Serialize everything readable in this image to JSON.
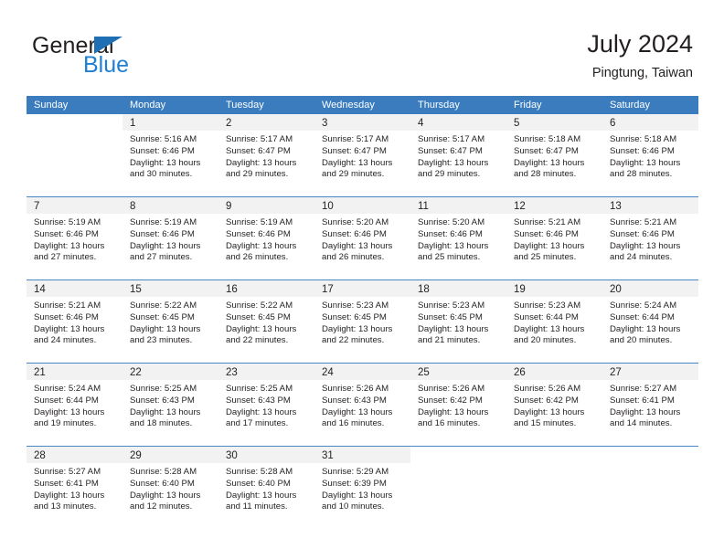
{
  "brand": {
    "name_part1": "General",
    "name_part2": "Blue",
    "triangle_color": "#1f6fb5",
    "blue_text_color": "#1f7fd0"
  },
  "header": {
    "title": "July 2024",
    "subtitle": "Pingtung, Taiwan"
  },
  "theme": {
    "header_row_bg": "#3a7cbe",
    "header_row_text": "#ffffff",
    "day_number_strip_bg": "#f2f2f2",
    "row_separator": "#4a86c5",
    "body_text": "#231f20"
  },
  "weekdays": [
    "Sunday",
    "Monday",
    "Tuesday",
    "Wednesday",
    "Thursday",
    "Friday",
    "Saturday"
  ],
  "weeks": [
    [
      {
        "day": "",
        "sunrise": "",
        "sunset": "",
        "daylight_line1": "",
        "daylight_line2": ""
      },
      {
        "day": "1",
        "sunrise": "Sunrise: 5:16 AM",
        "sunset": "Sunset: 6:46 PM",
        "daylight_line1": "Daylight: 13 hours",
        "daylight_line2": "and 30 minutes."
      },
      {
        "day": "2",
        "sunrise": "Sunrise: 5:17 AM",
        "sunset": "Sunset: 6:47 PM",
        "daylight_line1": "Daylight: 13 hours",
        "daylight_line2": "and 29 minutes."
      },
      {
        "day": "3",
        "sunrise": "Sunrise: 5:17 AM",
        "sunset": "Sunset: 6:47 PM",
        "daylight_line1": "Daylight: 13 hours",
        "daylight_line2": "and 29 minutes."
      },
      {
        "day": "4",
        "sunrise": "Sunrise: 5:17 AM",
        "sunset": "Sunset: 6:47 PM",
        "daylight_line1": "Daylight: 13 hours",
        "daylight_line2": "and 29 minutes."
      },
      {
        "day": "5",
        "sunrise": "Sunrise: 5:18 AM",
        "sunset": "Sunset: 6:47 PM",
        "daylight_line1": "Daylight: 13 hours",
        "daylight_line2": "and 28 minutes."
      },
      {
        "day": "6",
        "sunrise": "Sunrise: 5:18 AM",
        "sunset": "Sunset: 6:46 PM",
        "daylight_line1": "Daylight: 13 hours",
        "daylight_line2": "and 28 minutes."
      }
    ],
    [
      {
        "day": "7",
        "sunrise": "Sunrise: 5:19 AM",
        "sunset": "Sunset: 6:46 PM",
        "daylight_line1": "Daylight: 13 hours",
        "daylight_line2": "and 27 minutes."
      },
      {
        "day": "8",
        "sunrise": "Sunrise: 5:19 AM",
        "sunset": "Sunset: 6:46 PM",
        "daylight_line1": "Daylight: 13 hours",
        "daylight_line2": "and 27 minutes."
      },
      {
        "day": "9",
        "sunrise": "Sunrise: 5:19 AM",
        "sunset": "Sunset: 6:46 PM",
        "daylight_line1": "Daylight: 13 hours",
        "daylight_line2": "and 26 minutes."
      },
      {
        "day": "10",
        "sunrise": "Sunrise: 5:20 AM",
        "sunset": "Sunset: 6:46 PM",
        "daylight_line1": "Daylight: 13 hours",
        "daylight_line2": "and 26 minutes."
      },
      {
        "day": "11",
        "sunrise": "Sunrise: 5:20 AM",
        "sunset": "Sunset: 6:46 PM",
        "daylight_line1": "Daylight: 13 hours",
        "daylight_line2": "and 25 minutes."
      },
      {
        "day": "12",
        "sunrise": "Sunrise: 5:21 AM",
        "sunset": "Sunset: 6:46 PM",
        "daylight_line1": "Daylight: 13 hours",
        "daylight_line2": "and 25 minutes."
      },
      {
        "day": "13",
        "sunrise": "Sunrise: 5:21 AM",
        "sunset": "Sunset: 6:46 PM",
        "daylight_line1": "Daylight: 13 hours",
        "daylight_line2": "and 24 minutes."
      }
    ],
    [
      {
        "day": "14",
        "sunrise": "Sunrise: 5:21 AM",
        "sunset": "Sunset: 6:46 PM",
        "daylight_line1": "Daylight: 13 hours",
        "daylight_line2": "and 24 minutes."
      },
      {
        "day": "15",
        "sunrise": "Sunrise: 5:22 AM",
        "sunset": "Sunset: 6:45 PM",
        "daylight_line1": "Daylight: 13 hours",
        "daylight_line2": "and 23 minutes."
      },
      {
        "day": "16",
        "sunrise": "Sunrise: 5:22 AM",
        "sunset": "Sunset: 6:45 PM",
        "daylight_line1": "Daylight: 13 hours",
        "daylight_line2": "and 22 minutes."
      },
      {
        "day": "17",
        "sunrise": "Sunrise: 5:23 AM",
        "sunset": "Sunset: 6:45 PM",
        "daylight_line1": "Daylight: 13 hours",
        "daylight_line2": "and 22 minutes."
      },
      {
        "day": "18",
        "sunrise": "Sunrise: 5:23 AM",
        "sunset": "Sunset: 6:45 PM",
        "daylight_line1": "Daylight: 13 hours",
        "daylight_line2": "and 21 minutes."
      },
      {
        "day": "19",
        "sunrise": "Sunrise: 5:23 AM",
        "sunset": "Sunset: 6:44 PM",
        "daylight_line1": "Daylight: 13 hours",
        "daylight_line2": "and 20 minutes."
      },
      {
        "day": "20",
        "sunrise": "Sunrise: 5:24 AM",
        "sunset": "Sunset: 6:44 PM",
        "daylight_line1": "Daylight: 13 hours",
        "daylight_line2": "and 20 minutes."
      }
    ],
    [
      {
        "day": "21",
        "sunrise": "Sunrise: 5:24 AM",
        "sunset": "Sunset: 6:44 PM",
        "daylight_line1": "Daylight: 13 hours",
        "daylight_line2": "and 19 minutes."
      },
      {
        "day": "22",
        "sunrise": "Sunrise: 5:25 AM",
        "sunset": "Sunset: 6:43 PM",
        "daylight_line1": "Daylight: 13 hours",
        "daylight_line2": "and 18 minutes."
      },
      {
        "day": "23",
        "sunrise": "Sunrise: 5:25 AM",
        "sunset": "Sunset: 6:43 PM",
        "daylight_line1": "Daylight: 13 hours",
        "daylight_line2": "and 17 minutes."
      },
      {
        "day": "24",
        "sunrise": "Sunrise: 5:26 AM",
        "sunset": "Sunset: 6:43 PM",
        "daylight_line1": "Daylight: 13 hours",
        "daylight_line2": "and 16 minutes."
      },
      {
        "day": "25",
        "sunrise": "Sunrise: 5:26 AM",
        "sunset": "Sunset: 6:42 PM",
        "daylight_line1": "Daylight: 13 hours",
        "daylight_line2": "and 16 minutes."
      },
      {
        "day": "26",
        "sunrise": "Sunrise: 5:26 AM",
        "sunset": "Sunset: 6:42 PM",
        "daylight_line1": "Daylight: 13 hours",
        "daylight_line2": "and 15 minutes."
      },
      {
        "day": "27",
        "sunrise": "Sunrise: 5:27 AM",
        "sunset": "Sunset: 6:41 PM",
        "daylight_line1": "Daylight: 13 hours",
        "daylight_line2": "and 14 minutes."
      }
    ],
    [
      {
        "day": "28",
        "sunrise": "Sunrise: 5:27 AM",
        "sunset": "Sunset: 6:41 PM",
        "daylight_line1": "Daylight: 13 hours",
        "daylight_line2": "and 13 minutes."
      },
      {
        "day": "29",
        "sunrise": "Sunrise: 5:28 AM",
        "sunset": "Sunset: 6:40 PM",
        "daylight_line1": "Daylight: 13 hours",
        "daylight_line2": "and 12 minutes."
      },
      {
        "day": "30",
        "sunrise": "Sunrise: 5:28 AM",
        "sunset": "Sunset: 6:40 PM",
        "daylight_line1": "Daylight: 13 hours",
        "daylight_line2": "and 11 minutes."
      },
      {
        "day": "31",
        "sunrise": "Sunrise: 5:29 AM",
        "sunset": "Sunset: 6:39 PM",
        "daylight_line1": "Daylight: 13 hours",
        "daylight_line2": "and 10 minutes."
      },
      {
        "day": "",
        "sunrise": "",
        "sunset": "",
        "daylight_line1": "",
        "daylight_line2": ""
      },
      {
        "day": "",
        "sunrise": "",
        "sunset": "",
        "daylight_line1": "",
        "daylight_line2": ""
      },
      {
        "day": "",
        "sunrise": "",
        "sunset": "",
        "daylight_line1": "",
        "daylight_line2": ""
      }
    ]
  ]
}
